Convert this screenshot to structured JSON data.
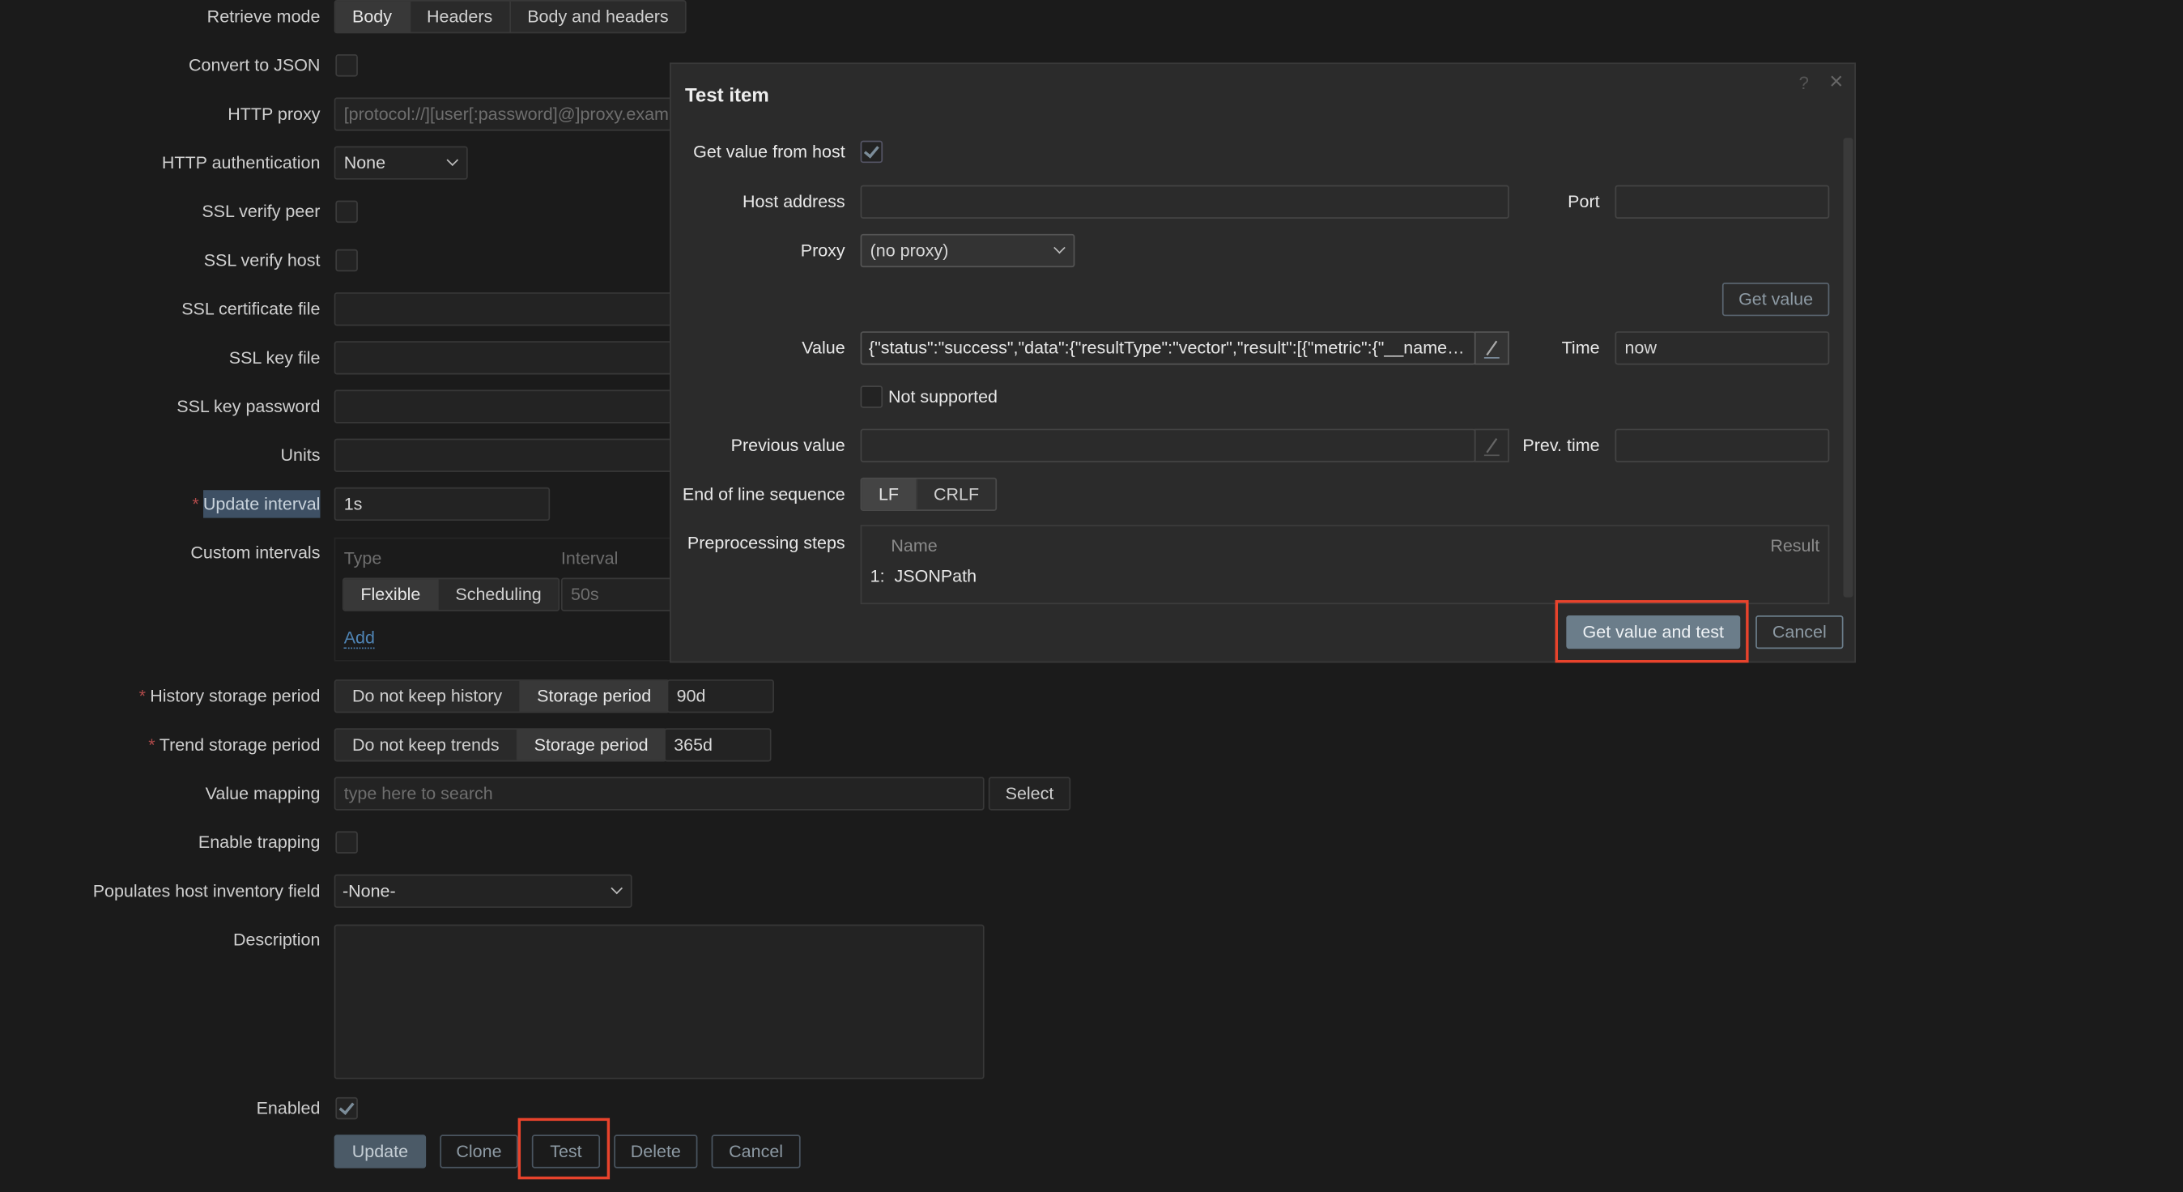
{
  "form": {
    "retrieve_mode": {
      "label": "Retrieve mode",
      "options": [
        "Body",
        "Headers",
        "Body and headers"
      ],
      "selected": "Body"
    },
    "convert_json": {
      "label": "Convert to JSON",
      "checked": false
    },
    "http_proxy": {
      "label": "HTTP proxy",
      "placeholder": "[protocol://][user[:password]@]proxy.example.com[:port]"
    },
    "http_auth": {
      "label": "HTTP authentication",
      "value": "None"
    },
    "ssl_verify_peer": {
      "label": "SSL verify peer",
      "checked": false
    },
    "ssl_verify_host": {
      "label": "SSL verify host",
      "checked": false
    },
    "ssl_cert_file": {
      "label": "SSL certificate file",
      "value": ""
    },
    "ssl_key_file": {
      "label": "SSL key file",
      "value": ""
    },
    "ssl_key_password": {
      "label": "SSL key password",
      "value": ""
    },
    "units": {
      "label": "Units",
      "value": ""
    },
    "update_interval": {
      "label": "Update interval",
      "value": "1s",
      "required": "*"
    },
    "custom_intervals": {
      "label": "Custom intervals",
      "col_type": "Type",
      "col_interval": "Interval",
      "options": [
        "Flexible",
        "Scheduling"
      ],
      "selected": "Flexible",
      "interval_placeholder": "50s",
      "add_link": "Add"
    },
    "history": {
      "label": "History storage period",
      "required": "*",
      "options": [
        "Do not keep history",
        "Storage period"
      ],
      "selected": "Storage period",
      "value": "90d"
    },
    "trend": {
      "label": "Trend storage period",
      "required": "*",
      "options": [
        "Do not keep trends",
        "Storage period"
      ],
      "selected": "Storage period",
      "value": "365d"
    },
    "value_mapping": {
      "label": "Value mapping",
      "placeholder": "type here to search",
      "select_button": "Select"
    },
    "enable_trapping": {
      "label": "Enable trapping",
      "checked": false
    },
    "inventory": {
      "label": "Populates host inventory field",
      "value": "-None-"
    },
    "description": {
      "label": "Description",
      "value": ""
    },
    "enabled": {
      "label": "Enabled",
      "checked": true
    },
    "buttons": {
      "update": "Update",
      "clone": "Clone",
      "test": "Test",
      "delete": "Delete",
      "cancel": "Cancel"
    }
  },
  "modal": {
    "title": "Test item",
    "help_icon": "?",
    "close_icon": "×",
    "get_value_from_host": {
      "label": "Get value from host",
      "checked": true
    },
    "host_address": {
      "label": "Host address",
      "value": ""
    },
    "port": {
      "label": "Port",
      "value": ""
    },
    "proxy": {
      "label": "Proxy",
      "value": "(no proxy)"
    },
    "get_value_button": "Get value",
    "value": {
      "label": "Value",
      "value": "{\"status\":\"success\",\"data\":{\"resultType\":\"vector\",\"result\":[{\"metric\":{\"__name_..."
    },
    "time": {
      "label": "Time",
      "value": "now"
    },
    "not_supported": {
      "label": "Not supported",
      "checked": false
    },
    "previous_value": {
      "label": "Previous value",
      "value": ""
    },
    "prev_time": {
      "label": "Prev. time",
      "value": ""
    },
    "eol": {
      "label": "End of line sequence",
      "options": [
        "LF",
        "CRLF"
      ],
      "selected": "LF"
    },
    "preprocessing": {
      "label": "Preprocessing steps",
      "col_name": "Name",
      "col_result": "Result",
      "steps": [
        {
          "num": "1:",
          "name": "JSONPath"
        }
      ]
    },
    "buttons": {
      "get_value_and_test": "Get value and test",
      "cancel": "Cancel"
    }
  },
  "colors": {
    "background": "#1b1b1b",
    "modal": "#2b2b2b",
    "primary_button": "#6b7d8a",
    "highlight": "#e8432c"
  }
}
